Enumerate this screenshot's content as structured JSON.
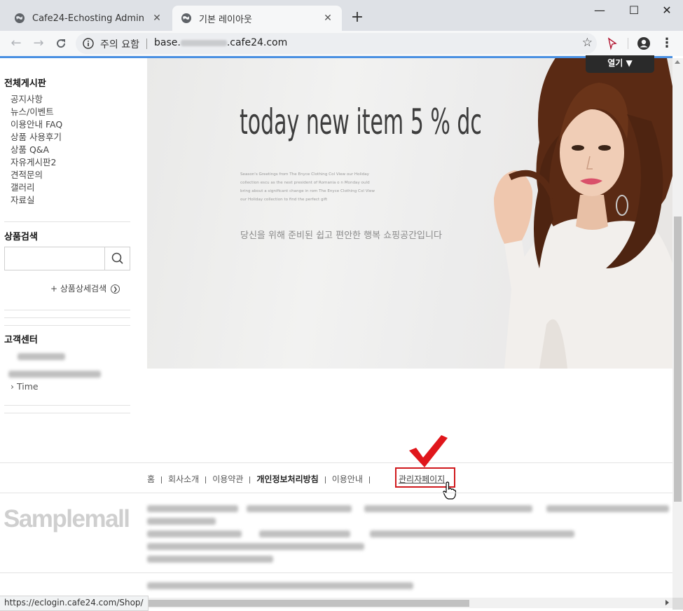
{
  "browser": {
    "tabs": [
      {
        "title": "Cafe24-Echosting Admin",
        "close": "✕",
        "active": false
      },
      {
        "title": "기본 레이아웃",
        "close": "✕",
        "active": true
      }
    ],
    "new_tab": "+",
    "window_controls": {
      "minimize": "—",
      "maximize": "☐",
      "close": "✕"
    },
    "address": {
      "security_label": "주의 요함",
      "url_prefix": "base.",
      "url_suffix": ".cafe24.com",
      "url_masked": true
    },
    "status_url": "https://eclogin.cafe24.com/Shop/"
  },
  "sidebar": {
    "board_title": "전체게시판",
    "boards": [
      "공지사항",
      "뉴스/이벤트",
      "이용안내 FAQ",
      "상품 사용후기",
      "상품 Q&A",
      "자유게시판2",
      "견적문의",
      "갤러리",
      "자료실"
    ],
    "search_title": "상품검색",
    "search_placeholder": "",
    "detail_search": "+ 상품상세검색",
    "cs_title": "고객센터",
    "time_label": "Time"
  },
  "banner": {
    "open_button": "열기 ▼",
    "headline": "today new item 5 % dc",
    "small_text": "Season's Greetings from The Enyce Clothing Col View our Holiday collection escu as the next president of Romania o n Monday ould bring about a significant change in rom The Enyce Clothing Col View our Holiday collection to find the perfect gift",
    "subtitle": "당신을 위해 준비된 쉽고 편안한 행복 쇼핑공간입니다"
  },
  "footer": {
    "links": [
      {
        "label": "홈",
        "bold": false
      },
      {
        "label": "회사소개",
        "bold": false
      },
      {
        "label": "이용약관",
        "bold": false
      },
      {
        "label": "개인정보처리방침",
        "bold": true
      },
      {
        "label": "이용안내",
        "bold": false
      }
    ],
    "admin_link": "관리자페이지",
    "logo": "Samplemall"
  },
  "colors": {
    "accent_blue": "#4a90e2",
    "highlight_red": "#d0191d",
    "checkmark_red": "#e0161b"
  }
}
